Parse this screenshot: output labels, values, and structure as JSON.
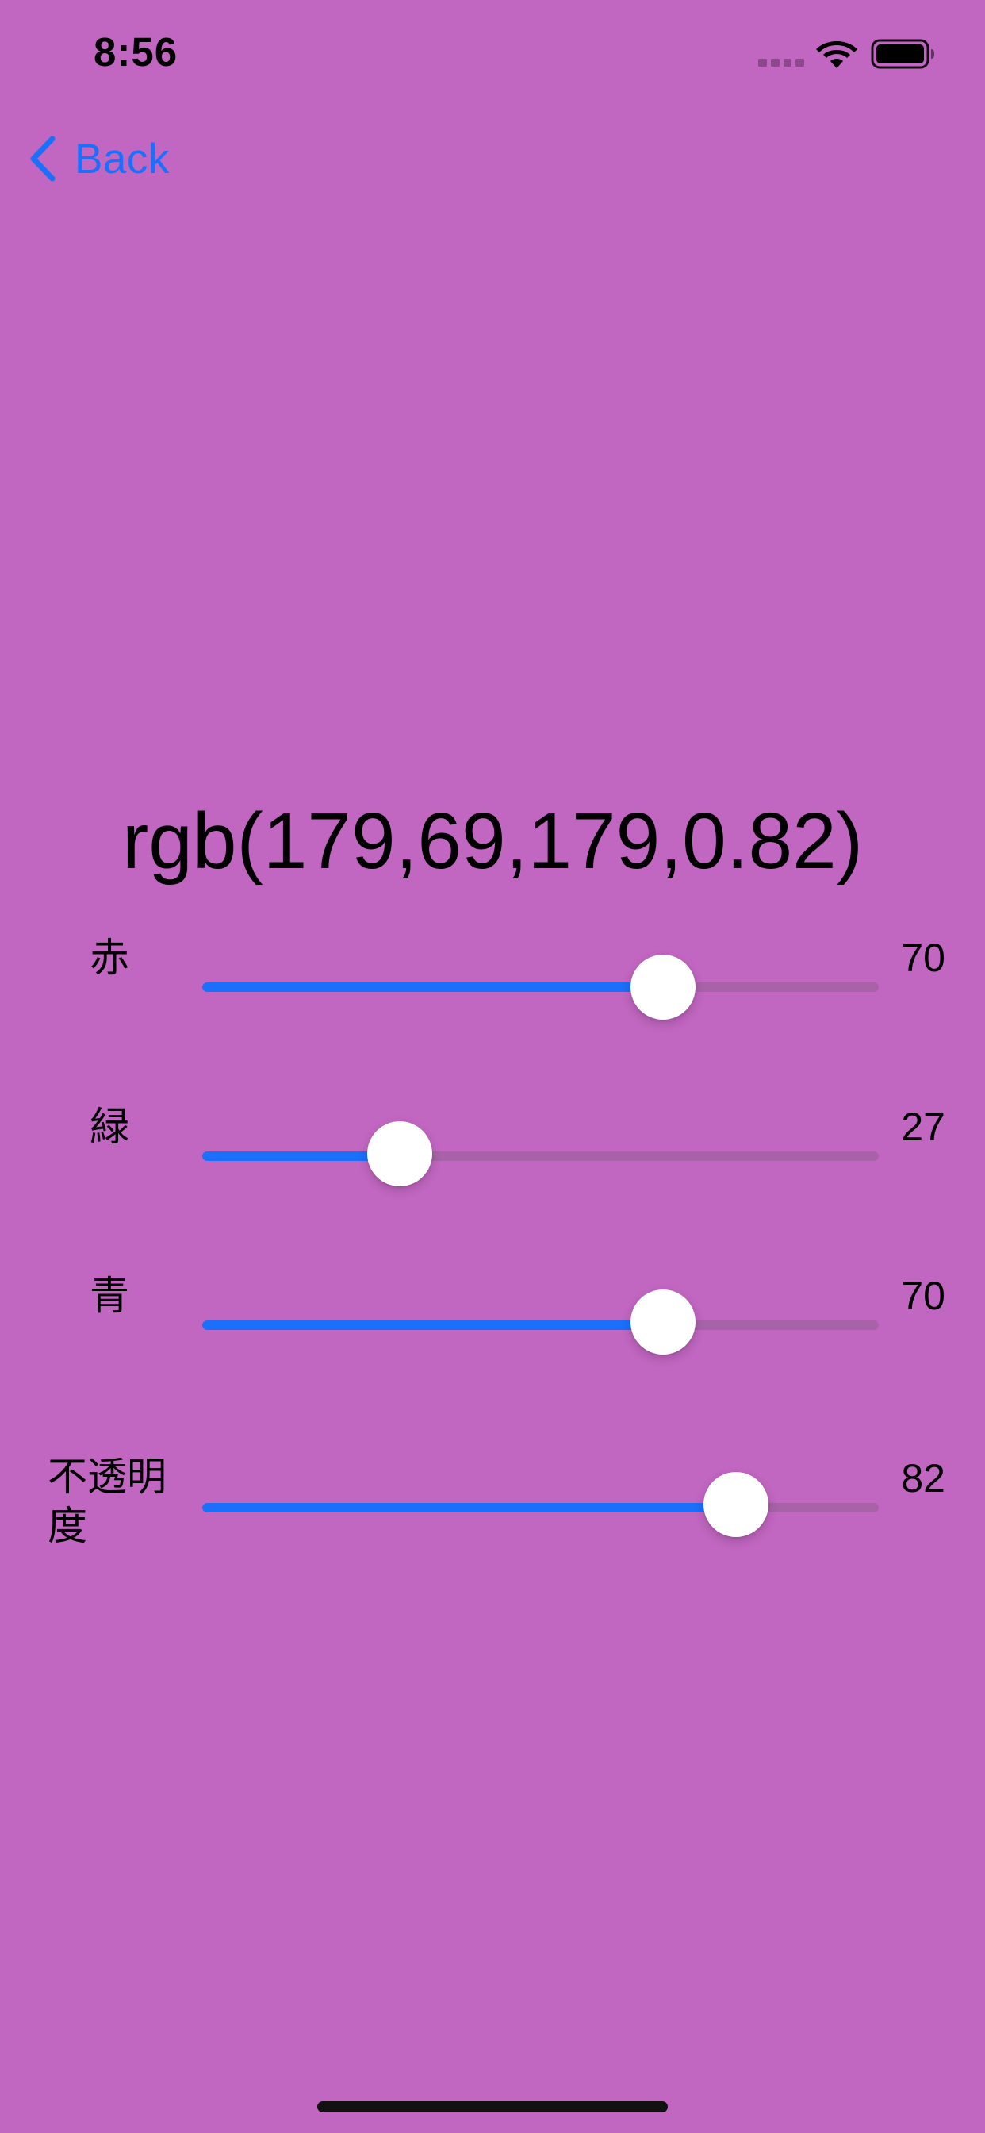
{
  "colors": {
    "background": "#c166c1",
    "accent": "#1a6ffb",
    "track_max": "#a862a8",
    "text": "#000000"
  },
  "status_bar": {
    "time": "8:56",
    "icons": [
      "cellular-signal-icon",
      "wifi-icon",
      "battery-icon"
    ]
  },
  "nav": {
    "back_label": "Back",
    "back_icon": "chevron-left-icon"
  },
  "rgb_text": "rgb(179,69,179,0.82)",
  "sliders": [
    {
      "label": "赤",
      "value": "70",
      "fraction": 0.7
    },
    {
      "label": "緑",
      "value": "27",
      "fraction": 0.27
    },
    {
      "label": "青",
      "value": "70",
      "fraction": 0.7
    },
    {
      "label": "不透明\n度",
      "value": "82",
      "fraction": 0.82
    }
  ]
}
